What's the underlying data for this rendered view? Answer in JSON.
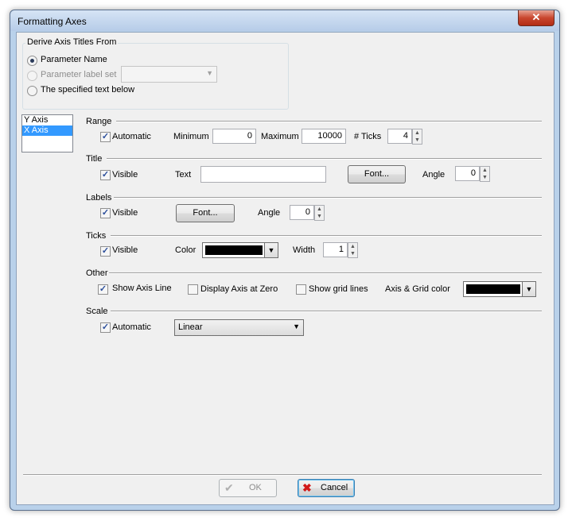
{
  "window": {
    "title": "Formatting Axes",
    "close_label": "✕"
  },
  "derive": {
    "title": "Derive Axis Titles From",
    "opt_param_name": "Parameter Name",
    "opt_label_set": "Parameter label set",
    "opt_specified": "The specified text below",
    "selected": "Parameter Name"
  },
  "axis_list": {
    "items": [
      "Y Axis",
      "X Axis"
    ],
    "selected": "X Axis"
  },
  "range": {
    "heading": "Range",
    "automatic_label": "Automatic",
    "automatic_checked": true,
    "minimum_label": "Minimum",
    "minimum_value": "0",
    "maximum_label": "Maximum",
    "maximum_value": "10000",
    "ticks_label": "# Ticks",
    "ticks_value": "4"
  },
  "title_section": {
    "heading": "Title",
    "visible_label": "Visible",
    "visible_checked": true,
    "text_label": "Text",
    "text_value": "",
    "font_button": "Font...",
    "angle_label": "Angle",
    "angle_value": "0"
  },
  "labels": {
    "heading": "Labels",
    "visible_label": "Visible",
    "visible_checked": true,
    "font_button": "Font...",
    "angle_label": "Angle",
    "angle_value": "0"
  },
  "ticks": {
    "heading": "Ticks",
    "visible_label": "Visible",
    "visible_checked": true,
    "color_label": "Color",
    "color_value": "#000000",
    "width_label": "Width",
    "width_value": "1"
  },
  "other": {
    "heading": "Other",
    "show_axis_line": "Show Axis Line",
    "show_axis_line_checked": true,
    "display_at_zero": "Display Axis at Zero",
    "display_at_zero_checked": false,
    "show_grid": "Show grid lines",
    "show_grid_checked": false,
    "grid_color_label": "Axis & Grid color",
    "grid_color_value": "#000000"
  },
  "scale": {
    "heading": "Scale",
    "automatic_label": "Automatic",
    "automatic_checked": true,
    "type_value": "Linear"
  },
  "footer": {
    "ok_label": "OK",
    "cancel_label": "Cancel"
  }
}
